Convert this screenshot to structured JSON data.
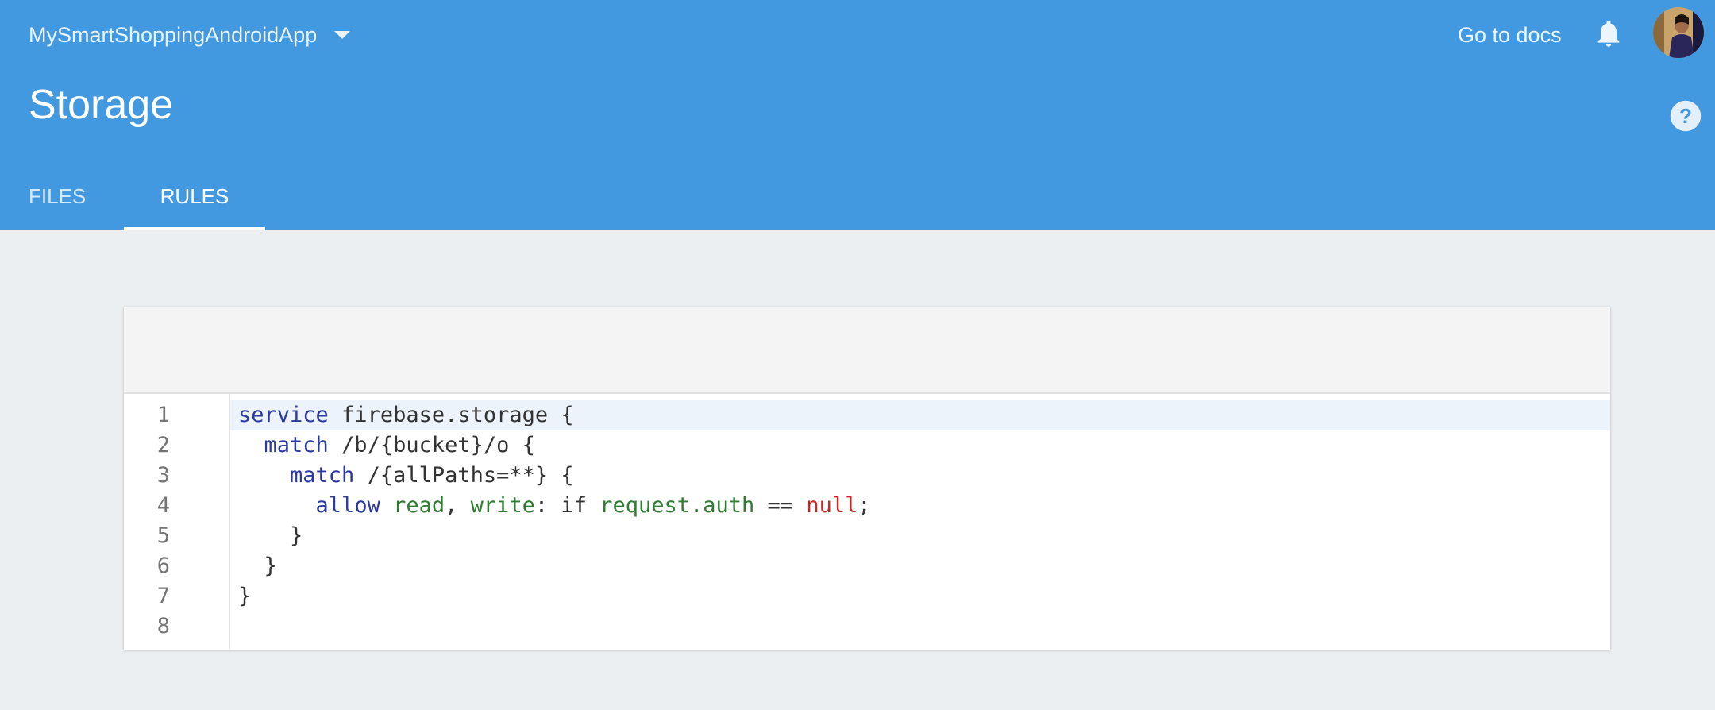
{
  "header": {
    "project_name": "MySmartShoppingAndroidApp",
    "go_to_docs": "Go to docs",
    "page_title": "Storage",
    "tabs": [
      {
        "label": "FILES",
        "active": false
      },
      {
        "label": "RULES",
        "active": true
      }
    ],
    "icons": {
      "project_dropdown": "arrow-drop-down-icon",
      "notifications": "bell-icon",
      "help": "help-icon"
    },
    "color": "#4399e0"
  },
  "editor": {
    "line_numbers": [
      "1",
      "2",
      "3",
      "4",
      "5",
      "6",
      "7",
      "8"
    ],
    "lines": [
      {
        "tokens": [
          [
            "service",
            "kw"
          ],
          [
            " firebase.storage {",
            "pl"
          ]
        ]
      },
      {
        "tokens": [
          [
            "  ",
            "pl"
          ],
          [
            "match",
            "kw"
          ],
          [
            " /b/{bucket}/o {",
            "pl"
          ]
        ]
      },
      {
        "tokens": [
          [
            "    ",
            "pl"
          ],
          [
            "match",
            "kw"
          ],
          [
            " /{allPaths=**} {",
            "pl"
          ]
        ]
      },
      {
        "tokens": [
          [
            "      ",
            "pl"
          ],
          [
            "allow",
            "kw"
          ],
          [
            " ",
            "pl"
          ],
          [
            "read",
            "id"
          ],
          [
            ", ",
            "pl"
          ],
          [
            "write",
            "id"
          ],
          [
            ": if ",
            "pl"
          ],
          [
            "request.auth",
            "id"
          ],
          [
            " == ",
            "pl"
          ],
          [
            "null",
            "nl"
          ],
          [
            ";",
            "pl"
          ]
        ]
      },
      {
        "tokens": [
          [
            "    }",
            "pl"
          ]
        ]
      },
      {
        "tokens": [
          [
            "  }",
            "pl"
          ]
        ]
      },
      {
        "tokens": [
          [
            "}",
            "pl"
          ]
        ]
      },
      {
        "tokens": []
      }
    ],
    "active_line": 1,
    "colors": {
      "keyword": "#2a3a9f",
      "identifier": "#2e7d32",
      "null_literal": "#c62828",
      "active_line_bg": "#ecf3fb"
    }
  }
}
